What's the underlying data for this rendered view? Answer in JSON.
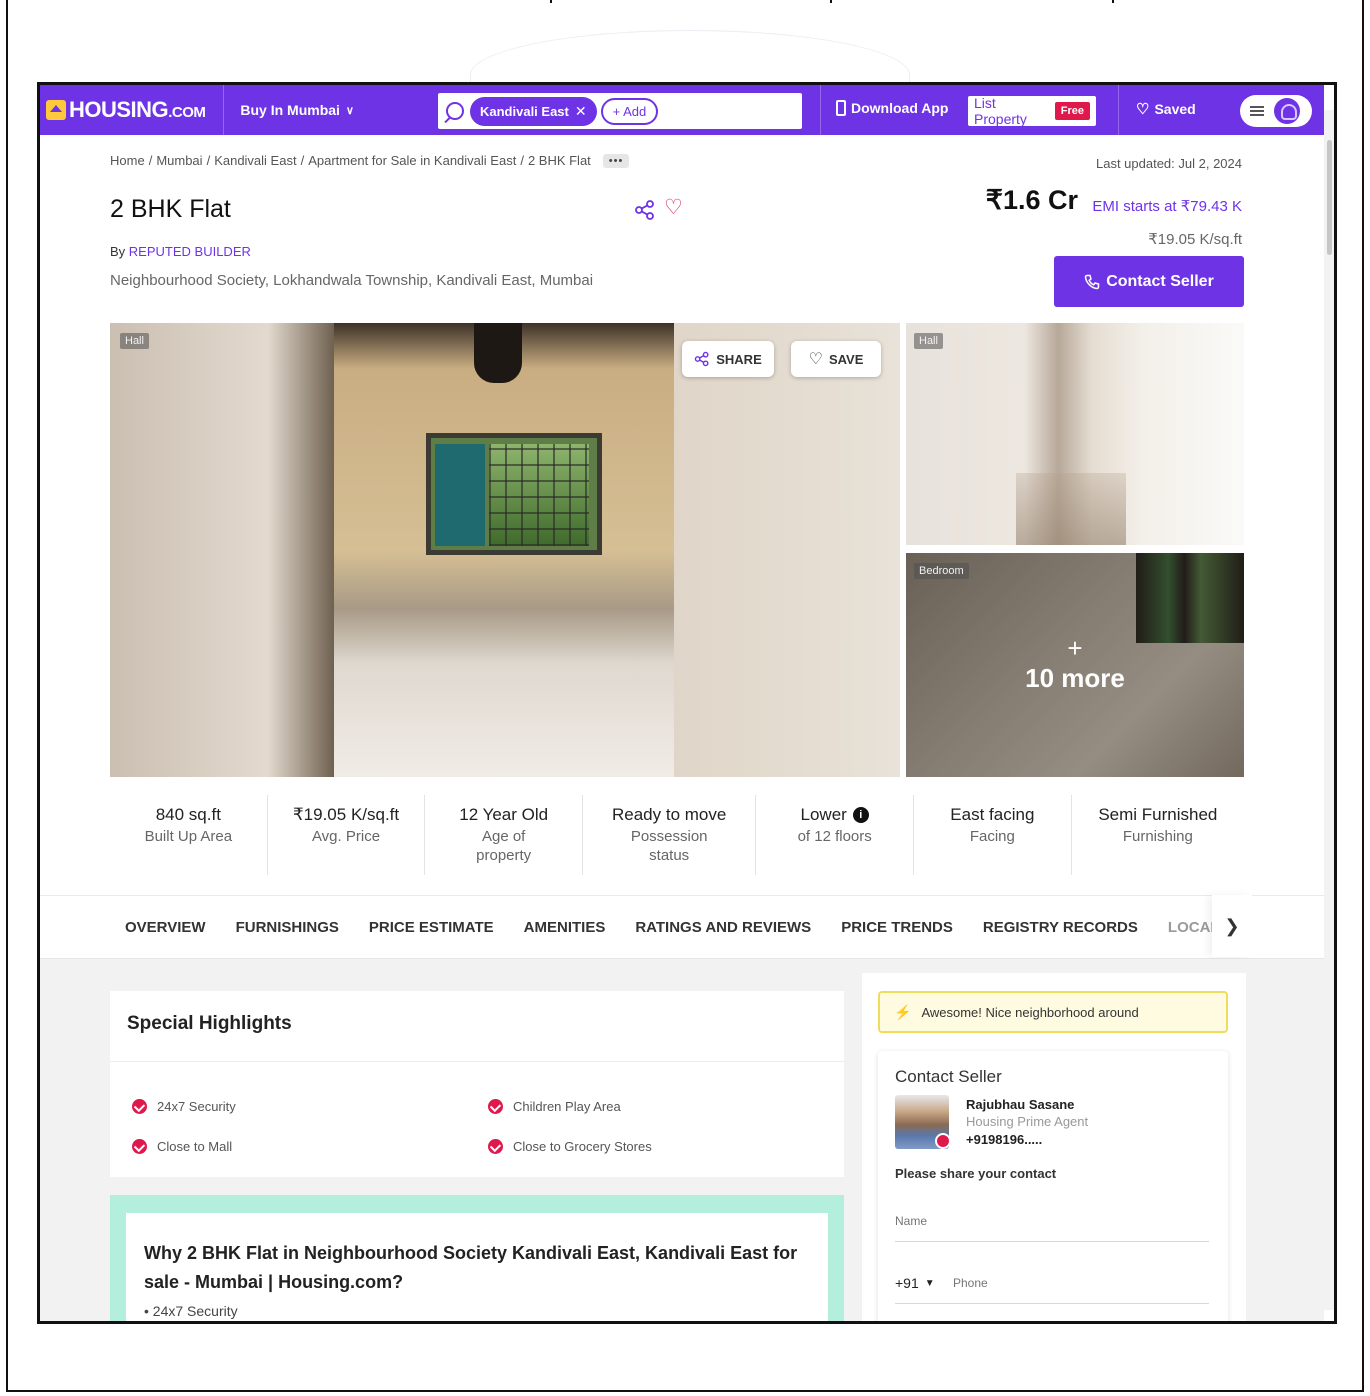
{
  "header": {
    "logo_main": "HOUSING",
    "logo_suffix": ".COM",
    "buy_in": "Buy In Mumbai",
    "search_chip": "Kandivali East",
    "add_chip": "+ Add",
    "download_app": "Download App",
    "list_property": "List Property",
    "free_badge": "Free",
    "saved": "Saved",
    "accent": "#6f33e6"
  },
  "breadcrumb": {
    "items": [
      "Home",
      "Mumbai",
      "Kandivali East",
      "Apartment for Sale in Kandivali East",
      "2 BHK Flat"
    ],
    "separator": "/",
    "more": "•••"
  },
  "listing": {
    "last_updated": "Last updated: Jul 2, 2024",
    "title": "2 BHK Flat",
    "by_prefix": "By",
    "builder": "REPUTED BUILDER",
    "address": "Neighbourhood Society, Lokhandwala Township, Kandivali East, Mumbai",
    "price": "₹1.6 Cr",
    "emi": "EMI starts at ₹79.43 K",
    "price_per_sqft": "₹19.05 K/sq.ft",
    "contact_button": "Contact Seller"
  },
  "gallery": {
    "main_tag": "Hall",
    "share_label": "SHARE",
    "save_label": "SAVE",
    "side1_tag": "Hall",
    "side2_tag": "Bedroom",
    "more_plus": "+",
    "more_label": "10 more"
  },
  "stats": [
    {
      "value": "840 sq.ft",
      "label": "Built Up Area"
    },
    {
      "value": "₹19.05 K/sq.ft",
      "label": "Avg. Price"
    },
    {
      "value": "12 Year Old",
      "label": "Age of property"
    },
    {
      "value": "Ready to move",
      "label": "Possession status"
    },
    {
      "value": "Lower",
      "label": "of 12 floors"
    },
    {
      "value": "East facing",
      "label": "Facing"
    },
    {
      "value": "Semi Furnished",
      "label": "Furnishing"
    }
  ],
  "tabs": [
    "OVERVIEW",
    "FURNISHINGS",
    "PRICE ESTIMATE",
    "AMENITIES",
    "RATINGS AND REVIEWS",
    "PRICE TRENDS",
    "REGISTRY RECORDS",
    "LOCALIT"
  ],
  "highlights": {
    "title": "Special Highlights",
    "items": [
      "24x7 Security",
      "Children Play Area",
      "Close to Mall",
      "Close to Grocery Stores"
    ]
  },
  "why": {
    "title": "Why 2 BHK Flat in Neighbourhood Society Kandivali East, Kandivali East for sale - Mumbai | Housing.com?",
    "first_item": "24x7 Security"
  },
  "rail": {
    "awesome": "Awesome! Nice neighborhood around",
    "contact_title": "Contact Seller",
    "agent_name": "Rajubhau Sasane",
    "agent_role": "Housing Prime Agent",
    "agent_phone": "+9198196.....",
    "share_prompt": "Please share your contact",
    "name_placeholder": "Name",
    "country_code": "+91",
    "phone_placeholder": "Phone"
  }
}
